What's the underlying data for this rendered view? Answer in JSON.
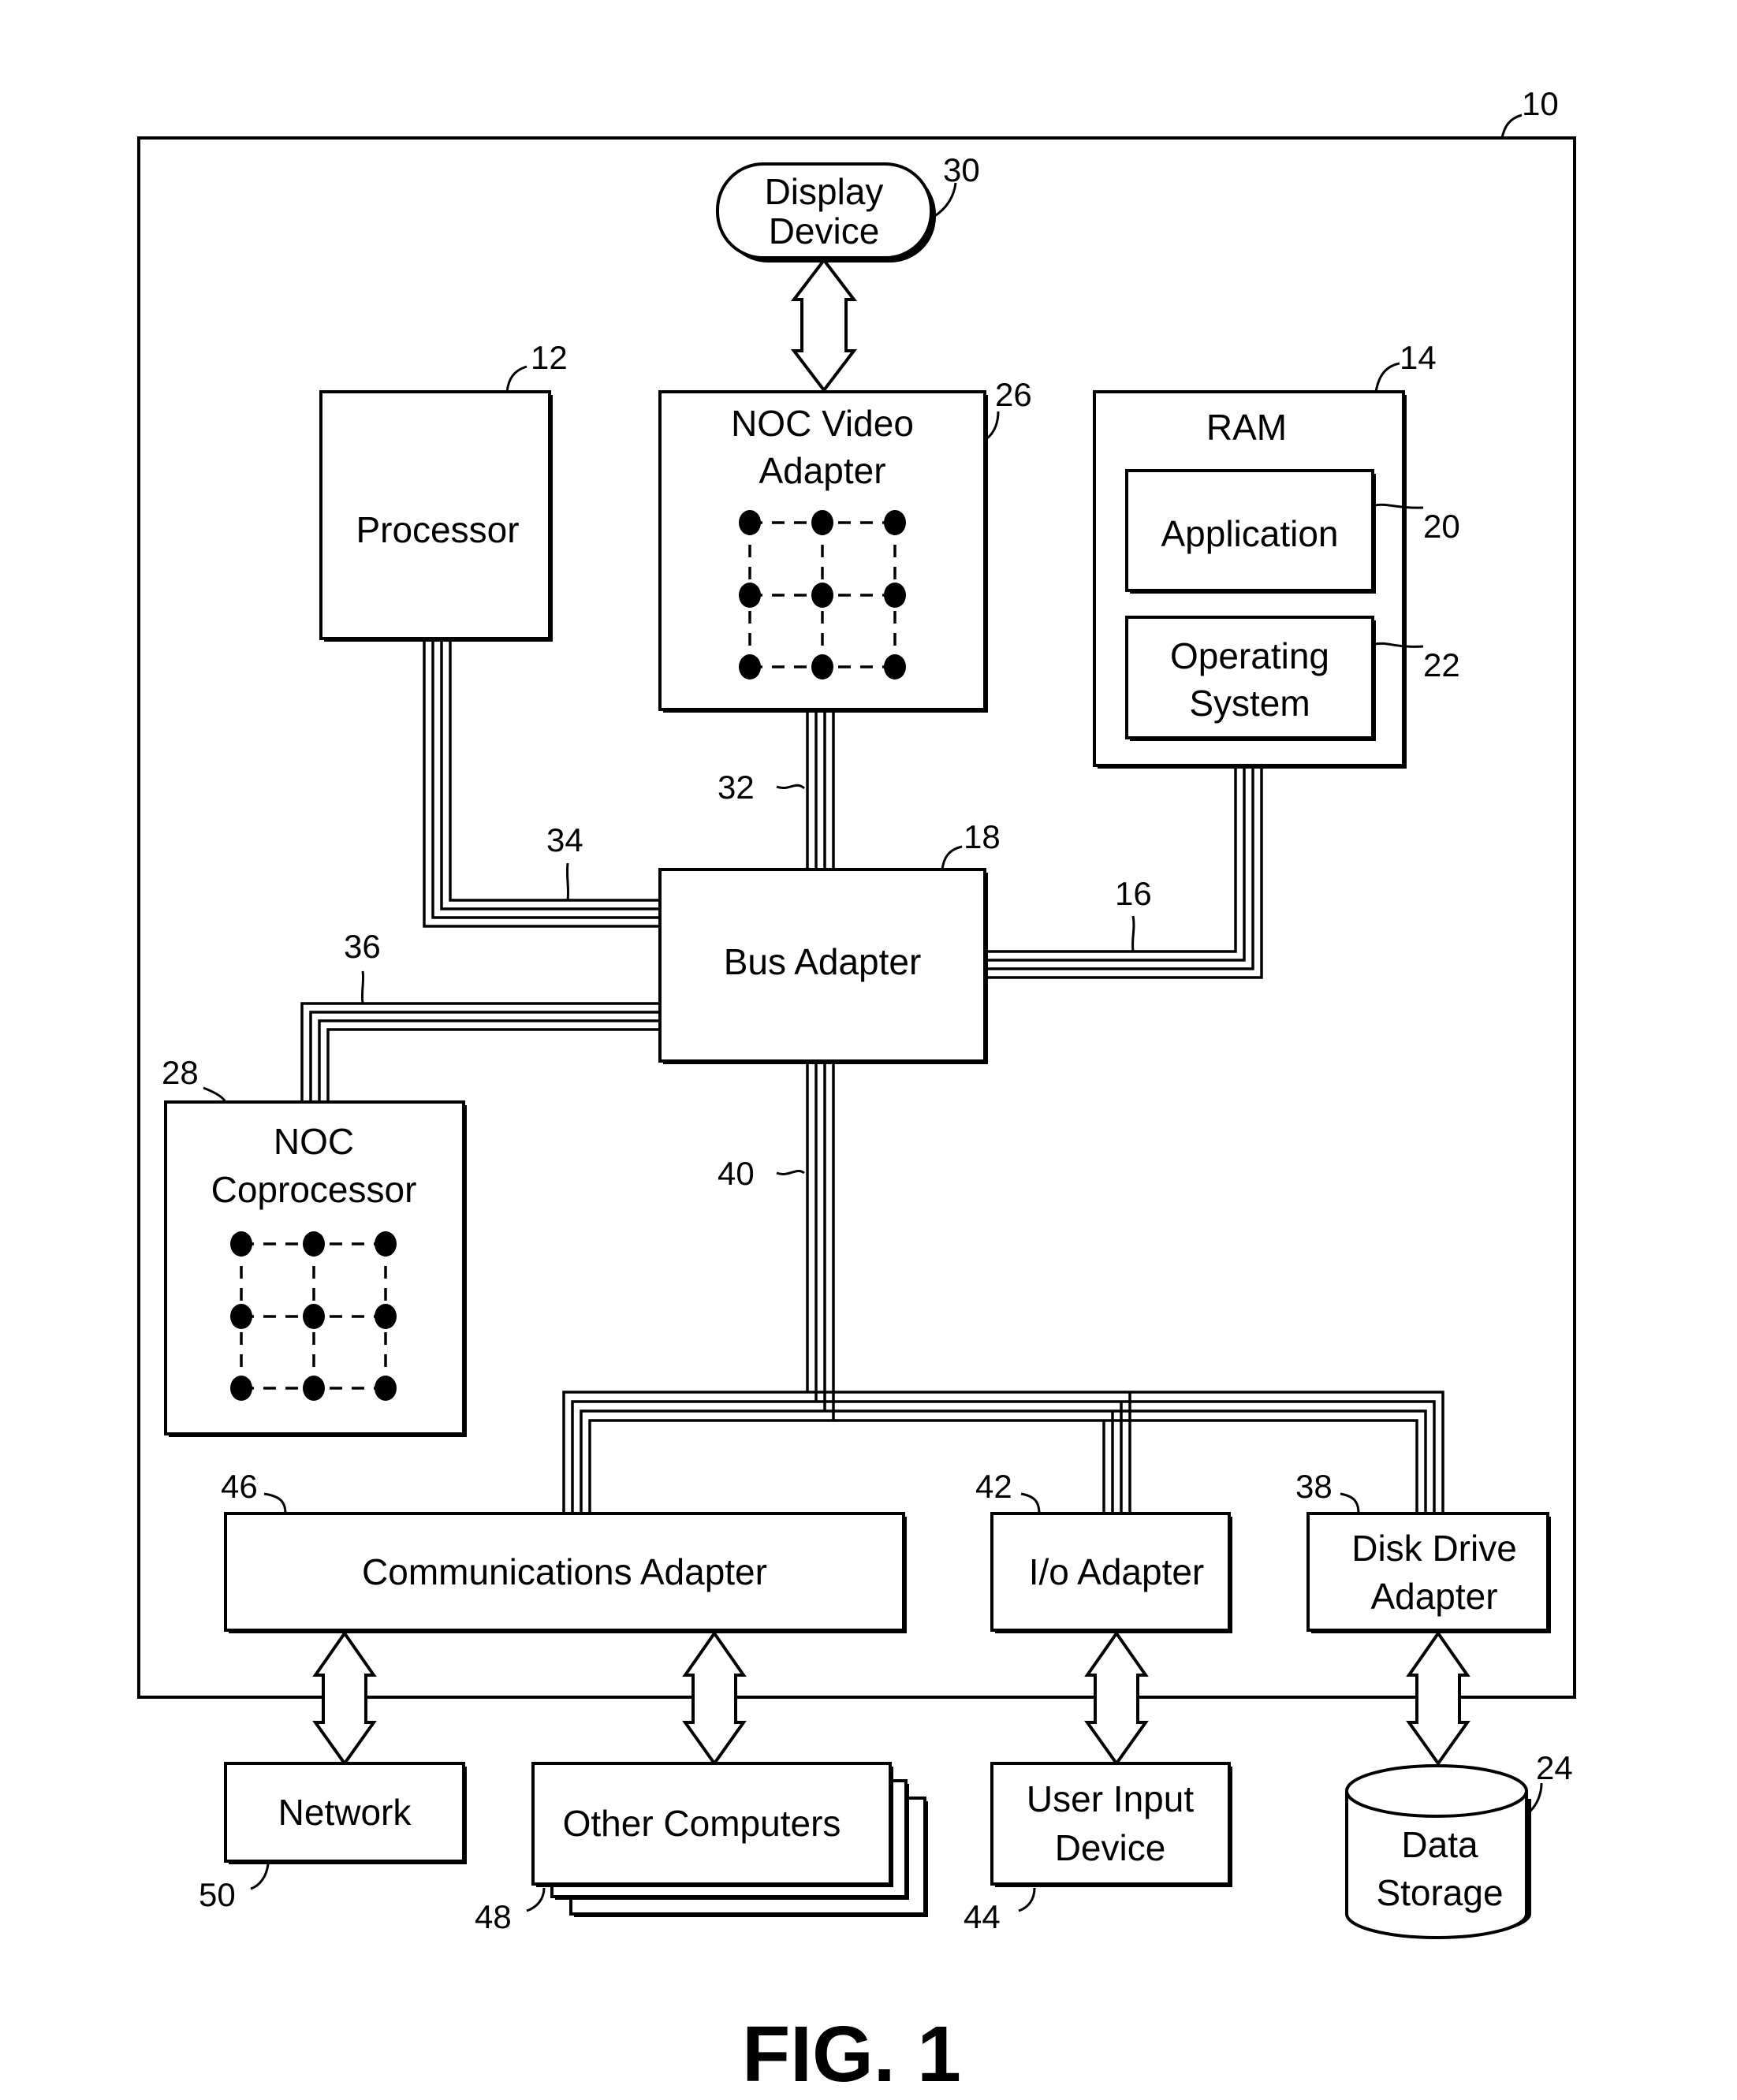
{
  "figure": {
    "title": "FIG. 1",
    "system_ref": "10"
  },
  "components": {
    "display_device": {
      "label_lines": [
        "Display",
        "Device"
      ],
      "ref": "30"
    },
    "processor": {
      "label": "Processor",
      "ref": "12"
    },
    "noc_video_adapter": {
      "label_lines": [
        "NOC Video",
        "Adapter"
      ],
      "ref": "26"
    },
    "ram": {
      "label": "RAM",
      "ref": "14"
    },
    "application": {
      "label": "Application",
      "ref": "20"
    },
    "operating_system": {
      "label_lines": [
        "Operating",
        "System"
      ],
      "ref": "22"
    },
    "bus_adapter": {
      "label": "Bus Adapter",
      "ref": "18"
    },
    "noc_coprocessor": {
      "label_lines": [
        "NOC",
        "Coprocessor"
      ],
      "ref": "28"
    },
    "communications_adapter": {
      "label": "Communications Adapter",
      "ref": "46"
    },
    "io_adapter": {
      "label": "I/o Adapter",
      "ref": "42"
    },
    "disk_drive_adapter": {
      "label_lines": [
        "Disk Drive",
        "Adapter"
      ],
      "ref": "38"
    },
    "network": {
      "label": "Network",
      "ref": "50"
    },
    "other_computers": {
      "label": "Other Computers",
      "ref": "48"
    },
    "user_input_device": {
      "label_lines": [
        "User Input",
        "Device"
      ],
      "ref": "44"
    },
    "data_storage": {
      "label_lines": [
        "Data",
        "Storage"
      ],
      "ref": "24"
    }
  },
  "buses": {
    "video_bus": {
      "ref": "32"
    },
    "front_side_bus": {
      "ref": "34"
    },
    "memory_bus": {
      "ref": "16"
    },
    "coprocessor_bus": {
      "ref": "36"
    },
    "expansion_bus": {
      "ref": "40"
    }
  }
}
